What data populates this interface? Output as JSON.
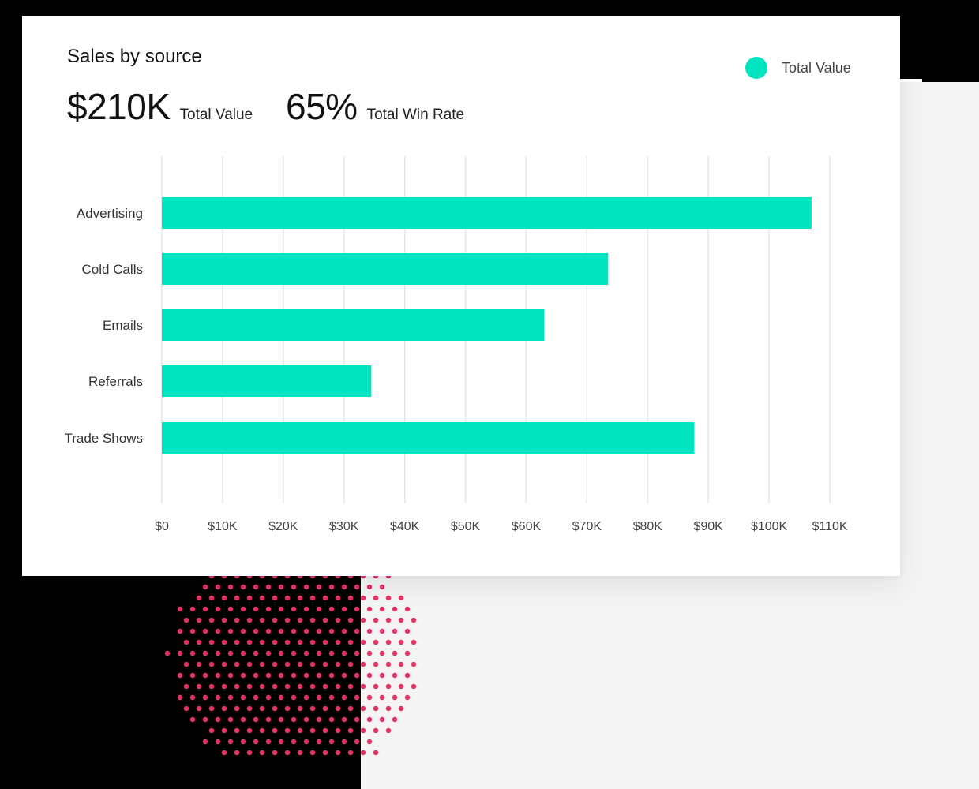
{
  "card": {
    "title": "Sales by source",
    "kpis": [
      {
        "value": "$210K",
        "label": "Total Value"
      },
      {
        "value": "65%",
        "label": "Total Win Rate"
      }
    ],
    "legend": {
      "label": "Total Value",
      "color": "#00e5c0"
    }
  },
  "chart_data": {
    "type": "bar",
    "orientation": "horizontal",
    "categories": [
      "Advertising",
      "Cold Calls",
      "Emails",
      "Referrals",
      "Trade Shows"
    ],
    "series": [
      {
        "name": "Total Value",
        "values": [
          107000,
          73500,
          63000,
          34500,
          87700
        ],
        "color": "#00e5c0"
      }
    ],
    "xlim": [
      0,
      110000
    ],
    "xticks": [
      0,
      10000,
      20000,
      30000,
      40000,
      50000,
      60000,
      70000,
      80000,
      90000,
      100000,
      110000
    ],
    "xtick_labels": [
      "$0",
      "$10K",
      "$20K",
      "$30K",
      "$40K",
      "$50K",
      "$60K",
      "$70K",
      "$80K",
      "$90K",
      "$100K",
      "$110K"
    ],
    "grid": true,
    "legend_position": "top-right"
  },
  "colors": {
    "accent": "#00e5c0",
    "dots": "#ee2e64"
  }
}
